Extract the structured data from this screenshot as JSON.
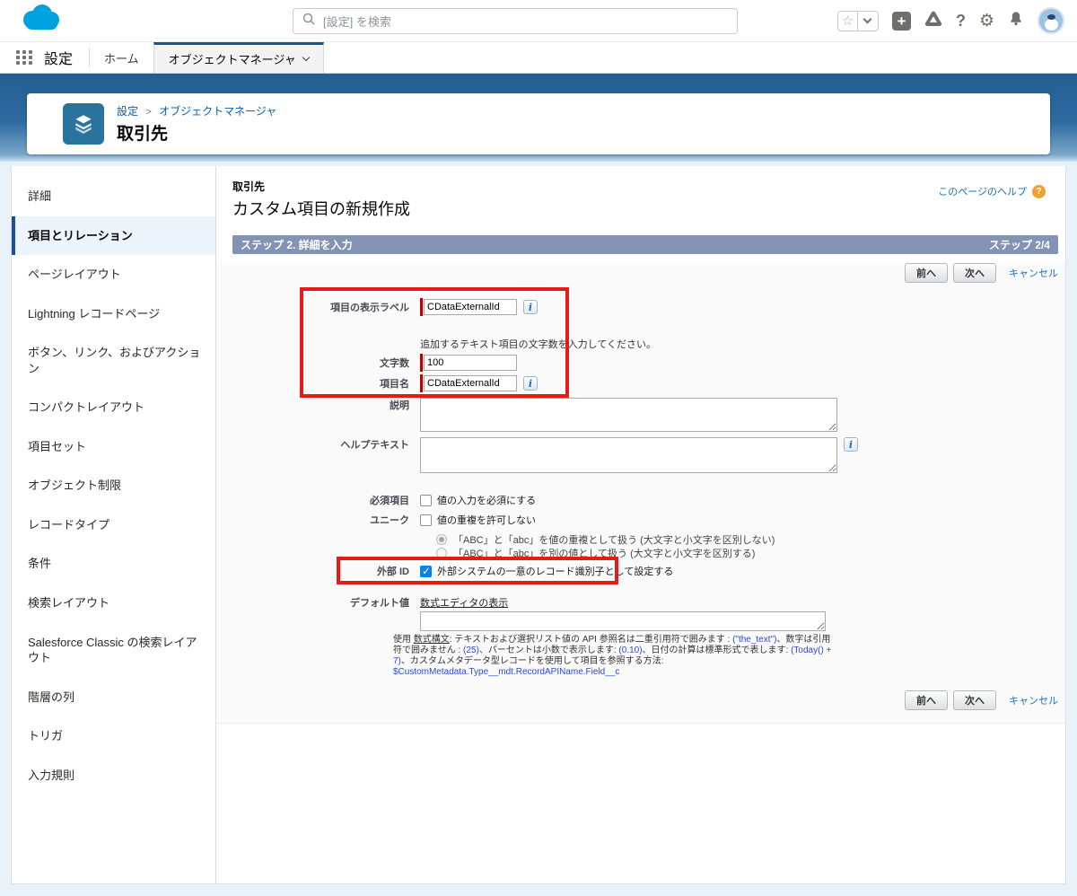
{
  "global_header": {
    "search": {
      "placeholder": "[設定] を検索"
    },
    "icons": [
      "salesforce-cloud-logo",
      "search-icon",
      "favorites-star-icon",
      "favorites-caret-icon",
      "global-add-icon",
      "guidance-center-icon",
      "help-icon",
      "setup-gear-icon",
      "notifications-bell-icon",
      "user-avatar"
    ],
    "help_glyph": "?",
    "gear_glyph": "⚙",
    "star_glyph": "☆",
    "plus_glyph": "+"
  },
  "nav": {
    "app_label": "設定",
    "tabs": [
      {
        "label": "ホーム",
        "active": false
      },
      {
        "label": "オブジェクトマネージャ",
        "active": true
      }
    ]
  },
  "page_header": {
    "breadcrumb": [
      {
        "label": "設定"
      },
      {
        "label": "オブジェクトマネージャ"
      }
    ],
    "separator": ">",
    "title": "取引先"
  },
  "sidebar": {
    "items": [
      {
        "label": "詳細",
        "active": false
      },
      {
        "label": "項目とリレーション",
        "active": true
      },
      {
        "label": "ページレイアウト",
        "active": false
      },
      {
        "label": "Lightning レコードページ",
        "active": false
      },
      {
        "label": "ボタン、リンク、およびアクション",
        "active": false
      },
      {
        "label": "コンパクトレイアウト",
        "active": false
      },
      {
        "label": "項目セット",
        "active": false
      },
      {
        "label": "オブジェクト制限",
        "active": false
      },
      {
        "label": "レコードタイプ",
        "active": false
      },
      {
        "label": "条件",
        "active": false
      },
      {
        "label": "検索レイアウト",
        "active": false
      },
      {
        "label": "Salesforce Classic の検索レイアウト",
        "active": false
      },
      {
        "label": "階層の列",
        "active": false
      },
      {
        "label": "トリガ",
        "active": false
      },
      {
        "label": "入力規則",
        "active": false
      }
    ]
  },
  "main": {
    "context_label": "取引先",
    "page_title": "カスタム項目の新規作成",
    "help_link": "このページのヘルプ",
    "help_glyph": "?",
    "step_bar": {
      "left": "ステップ 2. 詳細を入力",
      "right": "ステップ 2/4"
    },
    "buttons": {
      "prev": "前へ",
      "next": "次へ",
      "cancel": "キャンセル"
    },
    "form": {
      "field_label_row": {
        "label": "項目の表示ラベル",
        "value": "CDataExternalId",
        "required": true
      },
      "length_hint": "追加するテキスト項目の文字数を入力してください。",
      "length_row": {
        "label": "文字数",
        "value": "100",
        "required": true
      },
      "field_name_row": {
        "label": "項目名",
        "value": "CDataExternalId",
        "required": true
      },
      "description_row": {
        "label": "説明",
        "value": ""
      },
      "help_text_row": {
        "label": "ヘルプテキスト",
        "value": ""
      },
      "required_row": {
        "label": "必須項目",
        "checkbox_label": "値の入力を必須にする",
        "checked": false
      },
      "unique_row": {
        "label": "ユニーク",
        "checkbox_label": "値の重複を許可しない",
        "checked": false
      },
      "unique_options": [
        {
          "text": "「ABC」と「abc」を値の重複として扱う (大文字と小文字を区別しない)",
          "selected": true
        },
        {
          "text": "「ABC」と「abc」を別の値として扱う (大文字と小文字を区別する)",
          "selected": false
        }
      ],
      "external_id_row": {
        "label": "外部 ID",
        "checkbox_label": "外部システムの一意のレコード識別子として設定する",
        "checked": true
      },
      "default_value_row": {
        "label": "デフォルト値",
        "editor_link": "数式エディタの表示",
        "value": ""
      },
      "formula_hint_segments": [
        {
          "text": "使用 "
        },
        {
          "text": "数式構文"
        },
        {
          "text": ": テキストおよび選択リスト値の API 参照名は二重引用符で囲みます : "
        },
        {
          "text": "(\"the_text\")"
        },
        {
          "text": "、数字は引用符で囲みません : "
        },
        {
          "text": "(25)"
        },
        {
          "text": "、パーセントは小数で表示します: "
        },
        {
          "text": "(0.10)"
        },
        {
          "text": "、日付の計算は標準形式で表します: "
        },
        {
          "text": "(Today() + 7)"
        },
        {
          "text": "、カスタムメタデータ型レコードを使用して項目を参照する方法: "
        },
        {
          "text": "$CustomMetadata.Type__mdt.RecordAPIName.Field__c"
        }
      ]
    }
  },
  "colors": {
    "brand_cloud": "#00a1e0",
    "object_icon": "#2a739e",
    "step_bar": "#8393b5",
    "annotation_red": "#e41b17",
    "required_marker": "#c00000",
    "checkbox_checked": "#0b82e6",
    "active_tab_border": "#1b5297",
    "link_blue": "#1a6fc4"
  }
}
